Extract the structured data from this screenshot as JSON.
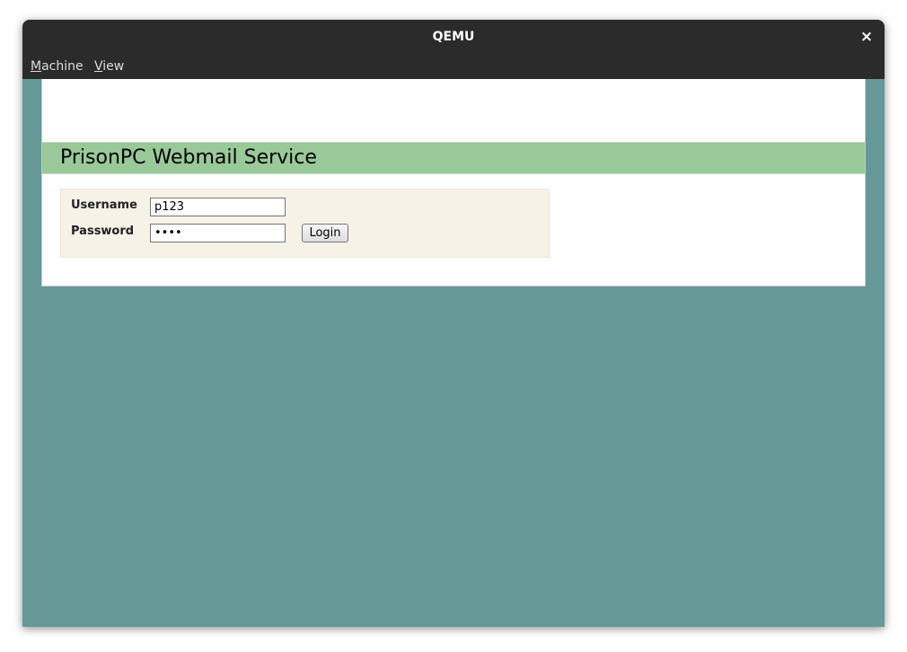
{
  "window": {
    "title": "QEMU",
    "close_glyph": "×"
  },
  "menubar": {
    "items": [
      {
        "mnemonic": "M",
        "rest": "achine"
      },
      {
        "mnemonic": "V",
        "rest": "iew"
      }
    ]
  },
  "page": {
    "banner_title": "PrisonPC Webmail Service",
    "login": {
      "username_label": "Username",
      "username_value": "p123",
      "password_label": "Password",
      "password_value": "1234",
      "login_button": "Login"
    }
  },
  "colors": {
    "desktop_bg": "#679898",
    "titlebar_bg": "#2b2b2b",
    "banner_bg": "#99c999",
    "login_box_bg": "#f6f2e8"
  }
}
